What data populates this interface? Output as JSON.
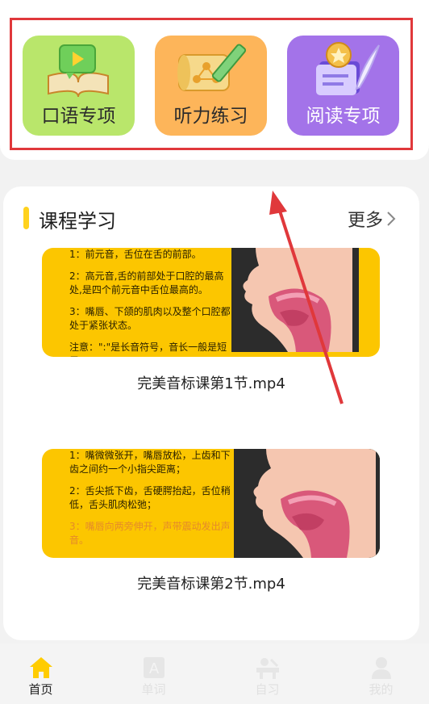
{
  "features": [
    {
      "label": "口语专项",
      "icon": "book-video-icon",
      "color": "#b9e66b"
    },
    {
      "label": "听力练习",
      "icon": "scroll-pencil-icon",
      "color": "#fdb55a"
    },
    {
      "label": "阅读专项",
      "icon": "medal-feather-icon",
      "color": "#a373e9"
    }
  ],
  "courses": {
    "title": "课程学习",
    "more": "更多",
    "items": [
      {
        "caption": "完美音标课第1节.mp4",
        "notes": [
          "1：前元音，舌位在舌的前部。",
          "2：高元音,舌的前部处于口腔的最高处,是四个前元音中舌位最高的。",
          "3：嘴唇、下颌的肌肉以及整个口腔都处于紧张状态。",
          "注意：\":\"是长音符号，音长一般是短元"
        ]
      },
      {
        "caption": "完美音标课第2节.mp4",
        "notes": [
          "1：嘴微微张开，嘴唇放松，上齿和下齿之间约一个小指尖距离；",
          "2：舌尖抵下齿，舌硬腭抬起，舌位稍低，舌头肌肉松弛；",
          "3：嘴唇向两旁伸开，声带震动发出声音。"
        ]
      }
    ]
  },
  "nav": [
    {
      "label": "首页",
      "icon": "home-icon",
      "active": true
    },
    {
      "label": "单词",
      "icon": "letter-a-icon",
      "active": false
    },
    {
      "label": "自习",
      "icon": "desk-study-icon",
      "active": false
    },
    {
      "label": "我的",
      "icon": "person-icon",
      "active": false
    }
  ],
  "colors": {
    "highlight": "#e0383b",
    "accent": "#ffd21e",
    "video_bg": "#fcc600",
    "nav_active": "#ffcc00"
  }
}
